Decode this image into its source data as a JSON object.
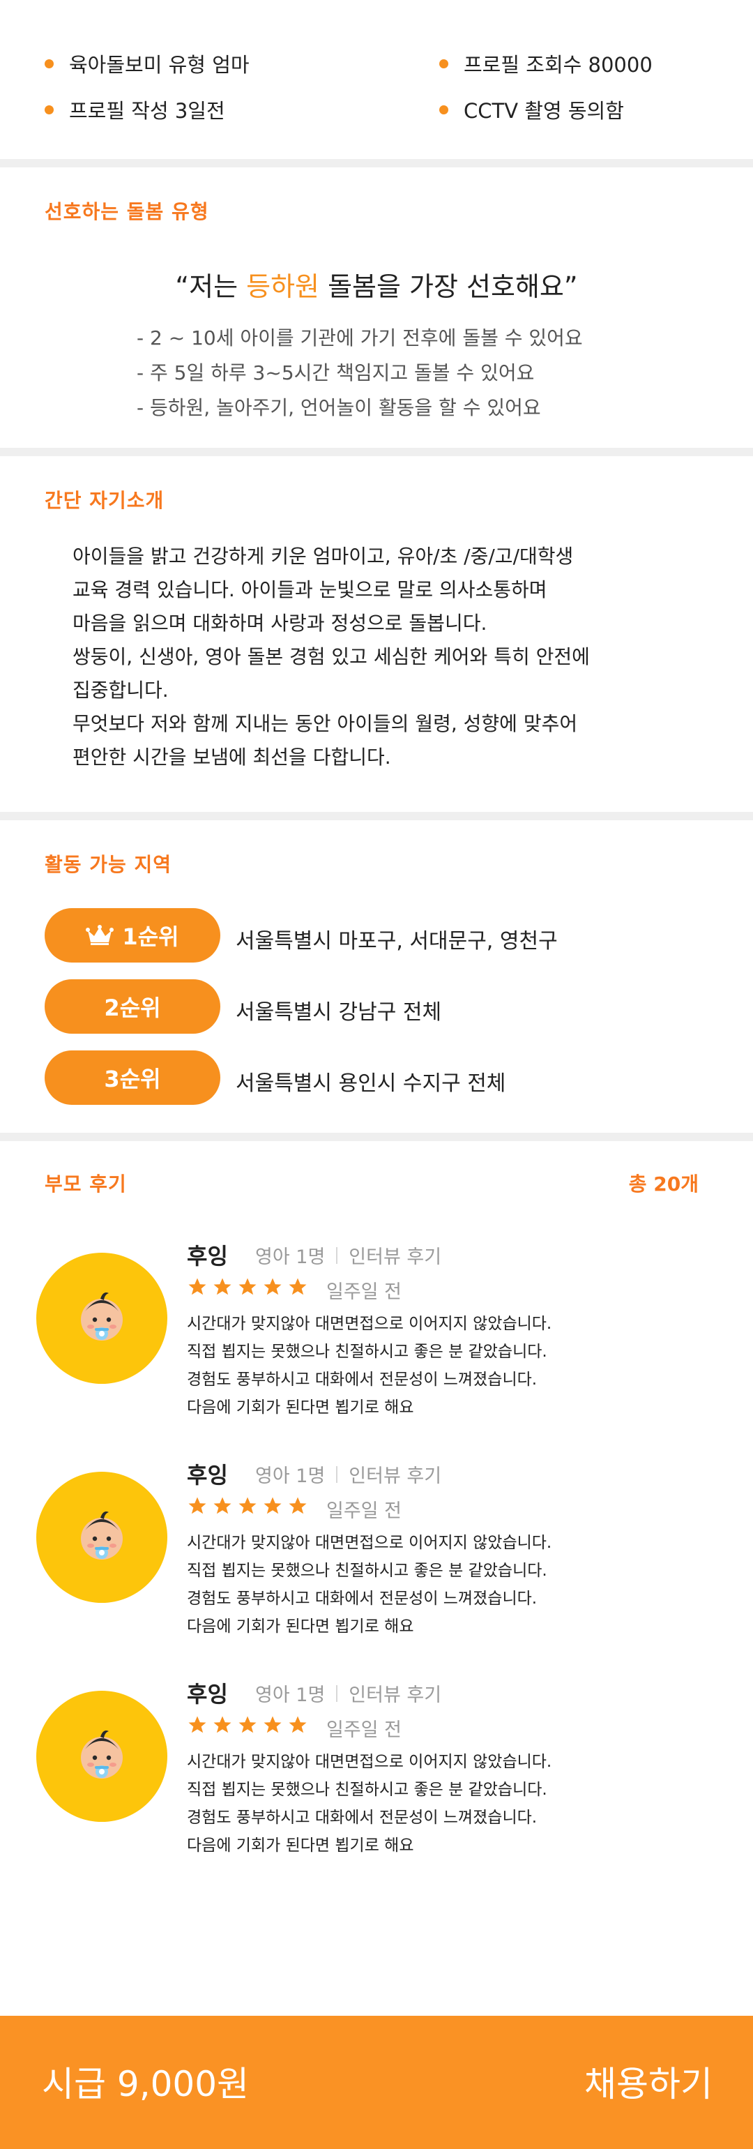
{
  "summary": {
    "items": [
      "육아돌보미 유형 엄마",
      "프로필 조회수 80000",
      "프로필 작성 3일전",
      "CCTV 촬영 동의함"
    ]
  },
  "care": {
    "title": "선호하는 돌봄 유형",
    "quote_prefix": "“저는 ",
    "quote_highlight": "등하원",
    "quote_suffix": " 돌봄을 가장 선호해요”",
    "lines": [
      "- 2 ~ 10세 아이를 기관에 가기 전후에 돌볼 수 있어요",
      "- 주 5일 하루 3~5시간 책임지고 돌볼 수 있어요",
      "- 등하원, 놀아주기, 언어놀이 활동을 할 수 있어요"
    ],
    "highlight_color": "#f7901e"
  },
  "intro": {
    "title": "간단 자기소개",
    "text": "아이들을 밝고 건강하게  키운 엄마이고, 유아/초 /중/고/대학생\n교육 경력 있습니다. 아이들과 눈빛으로 말로 의사소통하며\n마음을 읽으며 대화하며 사랑과 정성으로 돌봅니다.\n쌍둥이, 신생아, 영아 돌본 경험 있고 세심한 케어와 특히 안전에\n집중합니다.\n무엇보다 저와 함께 지내는 동안 아이들의 월령, 성향에 맞추어\n편안한 시간을 보냄에 최선을 다합니다."
  },
  "area": {
    "title": "활동 가능 지역",
    "ranks": [
      {
        "label": "1순위",
        "text": "서울특별시 마포구, 서대문구, 영천구",
        "icon": "crown-icon"
      },
      {
        "label": "2순위",
        "text": "서울특별시 강남구 전체"
      },
      {
        "label": "3순위",
        "text": "서울특별시 용인시 수지구 전체"
      }
    ]
  },
  "reviews": {
    "title": "부모 후기",
    "total": "총 20개",
    "rating_stars": 5,
    "items": [
      {
        "name": "후잉",
        "child": "영아 1명",
        "type": "인터뷰 후기",
        "date": "일주일 전",
        "text": "시간대가 맞지않아 대면면접으로 이어지지 않았습니다.\n직접 뵙지는 못했으나 친절하시고 좋은 분 같았습니다.\n경험도 풍부하시고 대화에서 전문성이 느껴졌습니다.\n다음에 기회가 된다면 뵙기로 해요"
      },
      {
        "name": "후잉",
        "child": "영아 1명",
        "type": "인터뷰 후기",
        "date": "일주일 전",
        "text": "시간대가 맞지않아 대면면접으로 이어지지 않았습니다.\n직접 뵙지는 못했으나 친절하시고 좋은 분 같았습니다.\n경험도 풍부하시고 대화에서 전문성이 느껴졌습니다.\n다음에 기회가 된다면 뵙기로 해요"
      },
      {
        "name": "후잉",
        "child": "영아 1명",
        "type": "인터뷰 후기",
        "date": "일주일 전",
        "text": "시간대가 맞지않아 대면면접으로 이어지지 않았습니다.\n직접 뵙지는 못했으나 친절하시고 좋은 분 같았습니다.\n경험도 풍부하시고 대화에서 전문성이 느껴졌습니다.\n다음에 기회가 된다면 뵙기로 해요"
      }
    ]
  },
  "bottom": {
    "wage": "시급 9,000원",
    "hire_label": "채용하기"
  },
  "colors": {
    "accent": "#f7901e",
    "title_orange": "#f7781e",
    "avatar_bg": "#fdc50b",
    "bottom_bar": "#fa9224"
  }
}
